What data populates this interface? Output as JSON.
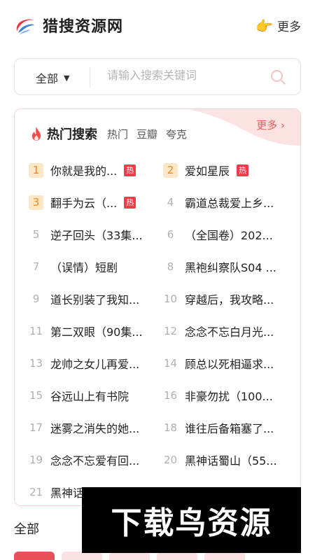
{
  "header": {
    "site_title": "猎搜资源网",
    "more_label": "更多",
    "hand_icon": "pointing-hand-icon",
    "colors": {
      "logo_red": "#e8323f",
      "logo_blue": "#3a7fd8"
    }
  },
  "search": {
    "scope": "全部",
    "placeholder": "请输入搜索关键词",
    "value": ""
  },
  "hot": {
    "title": "热门搜索",
    "sub_tabs": [
      "热门",
      "豆瓣",
      "夸克"
    ],
    "more_label": "更多 ›",
    "badge_text": "热",
    "accent": "#e8605a",
    "items": [
      {
        "rank": "1",
        "title": "你就是我的...",
        "hot": true
      },
      {
        "rank": "2",
        "title": "爱如星辰",
        "hot": true
      },
      {
        "rank": "3",
        "title": "翻手为云（...",
        "hot": true
      },
      {
        "rank": "4",
        "title": "霸道总裁爱上乡...",
        "hot": false
      },
      {
        "rank": "5",
        "title": "逆子回头（33集...",
        "hot": false
      },
      {
        "rank": "6",
        "title": "（全国卷）202...",
        "hot": false
      },
      {
        "rank": "7",
        "title": "（误情）短剧",
        "hot": false
      },
      {
        "rank": "8",
        "title": "黑袍纠察队S04 ...",
        "hot": false
      },
      {
        "rank": "9",
        "title": "道长别装了我知...",
        "hot": false
      },
      {
        "rank": "10",
        "title": "穿越后，我攻略...",
        "hot": false
      },
      {
        "rank": "11",
        "title": "第二双眼（90集...",
        "hot": false
      },
      {
        "rank": "12",
        "title": "念念不忘白月光...",
        "hot": false
      },
      {
        "rank": "13",
        "title": "龙帅之女儿再爱...",
        "hot": false
      },
      {
        "rank": "14",
        "title": "顾总以死相逼求...",
        "hot": false
      },
      {
        "rank": "15",
        "title": "谷远山上有书院",
        "hot": false
      },
      {
        "rank": "16",
        "title": "非豪勿扰（100...",
        "hot": false
      },
      {
        "rank": "17",
        "title": "迷雾之消失的她...",
        "hot": false
      },
      {
        "rank": "18",
        "title": "谁往后备箱塞了...",
        "hot": false
      },
      {
        "rank": "19",
        "title": "念念不忘爱有回...",
        "hot": false
      },
      {
        "rank": "20",
        "title": "黑神话蜀山（55...",
        "hot": false
      },
      {
        "rank": "21",
        "title": "黑神话之大夏无...",
        "hot": false
      }
    ]
  },
  "all_label": "全部",
  "watermark": "下载鸟资源"
}
